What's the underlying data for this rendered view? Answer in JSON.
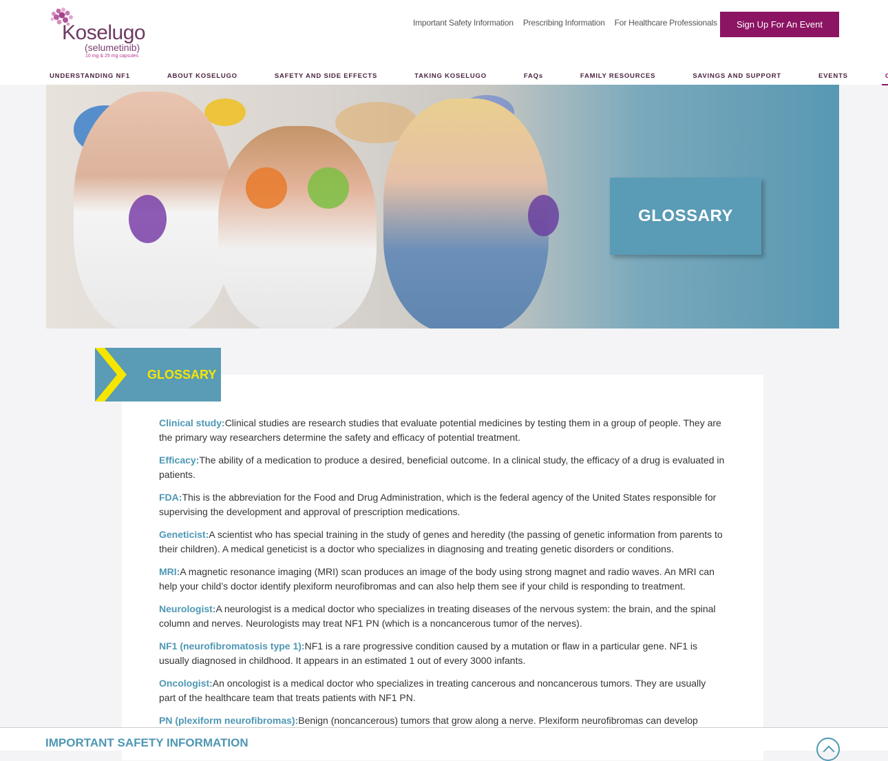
{
  "brand": {
    "name": "Koselugo",
    "generic": "(selumetinib)",
    "dose": "10 mg & 25 mg capsules",
    "brand_color": "#8b1463",
    "accent_color": "#4e97b4"
  },
  "utility_nav": [
    "Important Safety Information",
    "Prescribing Information",
    "For Healthcare Professionals"
  ],
  "social_icon": "facebook-icon",
  "cta_label": "Sign Up For An Event",
  "main_nav": [
    "UNDERSTANDING NF1",
    "ABOUT KOSELUGO",
    "SAFETY AND SIDE EFFECTS",
    "TAKING KOSELUGO",
    "FAQs",
    "FAMILY RESOURCES",
    "SAVINGS AND SUPPORT",
    "EVENTS",
    "GLOSSARY"
  ],
  "hero": {
    "title": "GLOSSARY"
  },
  "section_tag": "GLOSSARY",
  "terms": [
    {
      "name": "Clinical study:",
      "text": "Clinical studies are research studies that evaluate potential medicines by testing them in a group of people. They are the primary way researchers determine the safety and efficacy of potential treatment."
    },
    {
      "name": "Efficacy:",
      "text": "The ability of a medication to produce a desired, beneficial outcome. In a clinical study, the efficacy of a drug is evaluated in patients."
    },
    {
      "name": "FDA:",
      "text": "This is the abbreviation for the Food and Drug Administration, which is the federal agency of the United States responsible for supervising the development and approval of prescription medications."
    },
    {
      "name": "Geneticist:",
      "text": "A scientist who has special training in the study of genes and heredity (the passing of genetic information from parents to their children). A medical geneticist is a doctor who specializes in diagnosing and treating genetic disorders or conditions."
    },
    {
      "name": "MRI:",
      "text": "A magnetic resonance imaging (MRI) scan produces an image of the body using strong magnet and radio waves. An MRI can help your child’s doctor identify plexiform neurofibromas and can also help them see if your child is responding to treatment."
    },
    {
      "name": "Neurologist:",
      "text": "A neurologist is a medical doctor who specializes in treating diseases of the nervous system: the brain, and the spinal column and nerves. Neurologists may treat NF1 PN (which is a noncancerous tumor of the nerves)."
    },
    {
      "name": "NF1 (neurofibromatosis type 1):",
      "text": "NF1 is a rare progressive condition caused by a mutation or flaw in a particular gene. NF1 is usually diagnosed in childhood. It appears in an estimated 1 out of every 3000 infants."
    },
    {
      "name": "Oncologist:",
      "text": "An oncologist is a medical doctor who specializes in treating cancerous and noncancerous tumors. They are usually part of the healthcare team that treats patients with NF1 PN."
    },
    {
      "name": "PN (plexiform neurofibromas):",
      "text": "Benign (noncancerous) tumors that grow along a nerve. Plexiform neurofibromas can develop anywhere"
    }
  ],
  "isi": {
    "title": "IMPORTANT SAFETY INFORMATION"
  }
}
